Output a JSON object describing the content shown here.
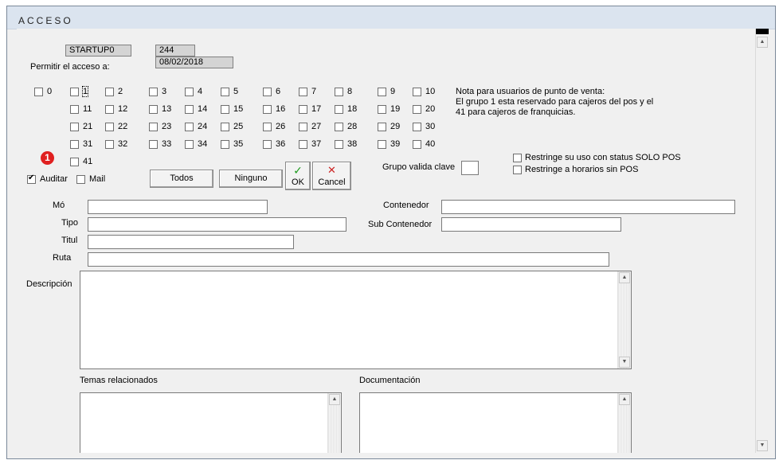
{
  "window": {
    "title": "ACCESO"
  },
  "header": {
    "user_code": "STARTUP0",
    "number": "244",
    "date": "08/02/2018",
    "permit_label": "Permitir el acceso a:"
  },
  "groups": {
    "rows": [
      [
        "0",
        "1",
        "2",
        "3",
        "4",
        "5",
        "6",
        "7",
        "8",
        "9",
        "10"
      ],
      [
        "11",
        "12",
        "13",
        "14",
        "15",
        "16",
        "17",
        "18",
        "19",
        "20"
      ],
      [
        "21",
        "22",
        "23",
        "24",
        "25",
        "26",
        "27",
        "28",
        "29",
        "30"
      ],
      [
        "31",
        "32",
        "33",
        "34",
        "35",
        "36",
        "37",
        "38",
        "39",
        "40"
      ],
      [
        "41"
      ]
    ]
  },
  "note": {
    "line1": "Nota para usuarios de punto de venta:",
    "line2": "El grupo 1 esta reservado para cajeros del pos y el",
    "line3": "41 para cajeros de franquicias."
  },
  "badge": {
    "number": "1",
    "color": "#e02020"
  },
  "options": {
    "auditar": "Auditar",
    "mail": "Mail"
  },
  "buttons": {
    "todos": "Todos",
    "ninguno": "Ninguno",
    "ok": "OK",
    "cancel": "Cancel"
  },
  "grupo_valida": {
    "label": "Grupo valida clave"
  },
  "restrict": {
    "solo_pos": "Restringe su uso con status  SOLO POS",
    "horarios": "Restringe a horarios sin POS"
  },
  "fields": {
    "modulo": "Mó",
    "tipo": "Tipo",
    "titulo": "Titul",
    "ruta": "Ruta",
    "contenedor": "Contenedor",
    "sub_contenedor": "Sub Contenedor",
    "descripcion": "Descripción",
    "temas": "Temas relacionados",
    "documentacion": "Documentación"
  },
  "colors": {
    "ok_check": "#1a9a1a",
    "cancel_x": "#cc2222",
    "readonly_bg": "#d4d4d4"
  }
}
